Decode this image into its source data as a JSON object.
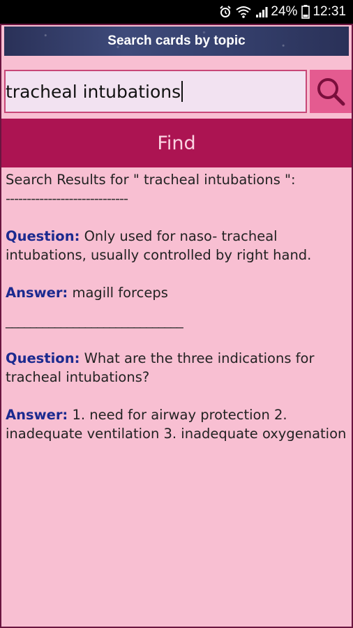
{
  "status_bar": {
    "battery": "24%",
    "time": "12:31",
    "icons": [
      "alarm-icon",
      "wifi-icon",
      "signal-icon",
      "battery-icon"
    ]
  },
  "app": {
    "title": "Search cards by topic"
  },
  "search": {
    "value": "tracheal intubations",
    "find_label": "Find"
  },
  "results": {
    "header": "Search Results for \" tracheal intubations \":",
    "separator": "-----------------------------",
    "items": [
      {
        "question_label": "Question:",
        "question": " Only used for naso- tracheal intubations, usually controlled by right hand.",
        "answer_label": "Answer:",
        "answer": " magill forceps"
      },
      {
        "question_label": "Question:",
        "question": " What are the three indications for tracheal intubations?",
        "answer_label": "Answer:",
        "answer": " 1. need for airway protection 2. inadequate ventilation 3. inadequate oxygenation"
      }
    ],
    "item_separator": "_____________________________"
  },
  "colors": {
    "background": "#f8bfd2",
    "find_button": "#ac1452",
    "search_button": "#e45b90",
    "label": "#1b2a8f"
  }
}
